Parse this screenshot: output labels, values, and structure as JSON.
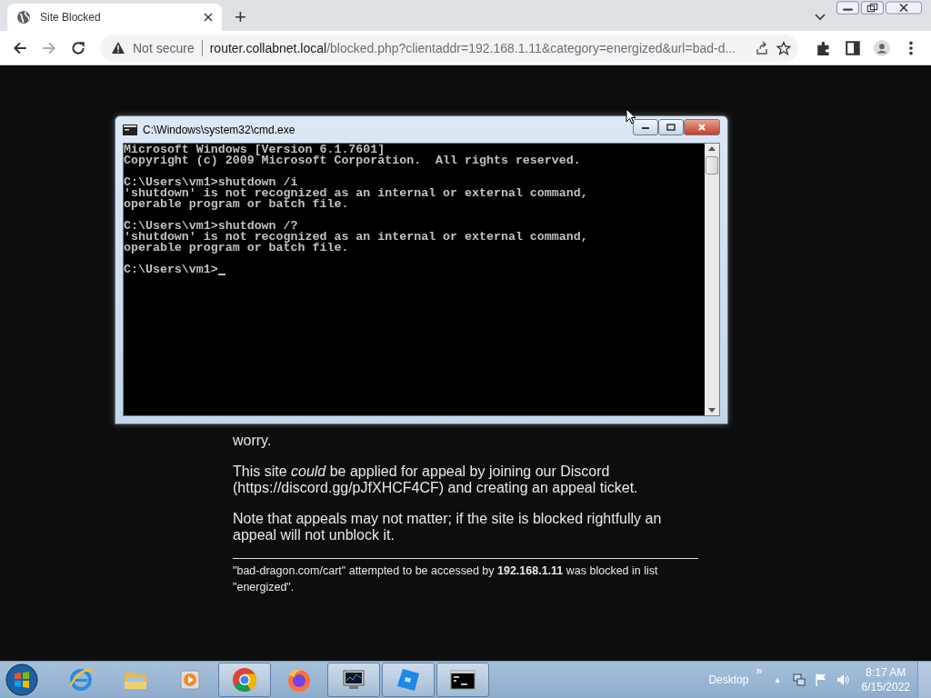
{
  "browser": {
    "tab": {
      "title": "Site Blocked",
      "selected": true
    },
    "new_tab": "+",
    "address": {
      "security": "Not secure",
      "host": "router.collabnet.local",
      "path": "/blocked.php?clientaddr=192.168.1.11&category=energized&url=bad-d..."
    }
  },
  "page": {
    "paragraphs": [
      "worry.",
      "This site *could* be applied for appeal by joining our Discord (https://discord.gg/pJfXHCF4CF) and creating an appeal ticket.",
      "Note that appeals may not matter; if the site is blocked rightfully an appeal will not unblock it."
    ],
    "footer": "\"bad-dragon.com/cart\" attempted to be accessed by **192.168.1.11** was blocked in list \"energized\"."
  },
  "console": {
    "title": "C:\\Windows\\system32\\cmd.exe",
    "blocks": [
      [
        "Microsoft Windows [Version 6.1.7601]",
        "Copyright (c) 2009 Microsoft Corporation.  All rights reserved."
      ],
      [
        "C:\\Users\\vm1>shutdown /i",
        "'shutdown' is not recognized as an internal or external command,",
        "operable program or batch file."
      ],
      [
        "C:\\Users\\vm1>shutdown /?",
        "'shutdown' is not recognized as an internal or external command,",
        "operable program or batch file."
      ],
      [
        "C:\\Users\\vm1>"
      ]
    ]
  },
  "taskbar": {
    "items": [
      {
        "kind": "ie",
        "running": false
      },
      {
        "kind": "folder",
        "running": false
      },
      {
        "kind": "media",
        "running": false
      },
      {
        "kind": "chrome",
        "running": true
      },
      {
        "kind": "firefox",
        "running": false
      },
      {
        "kind": "monitor",
        "running": true
      },
      {
        "kind": "cube",
        "running": true
      },
      {
        "kind": "cmd",
        "running": true
      }
    ],
    "desktop": "Desktop",
    "chevron": "»",
    "tray_arrow": "▲",
    "time": "8:17 AM",
    "date": "6/15/2022"
  }
}
